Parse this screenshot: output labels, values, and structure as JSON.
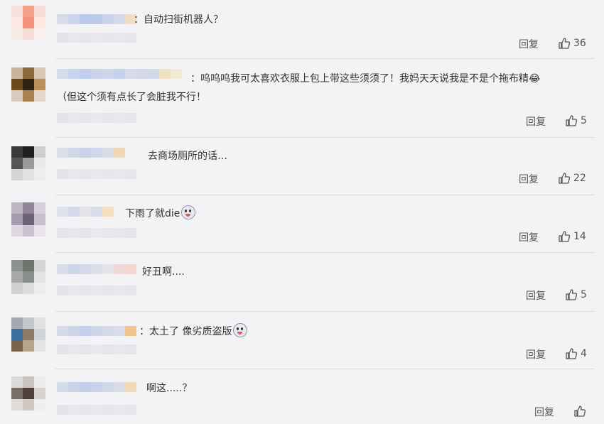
{
  "comments": [
    {
      "text": "：自动扫街机器人？",
      "reply": "回复",
      "likes": "36"
    },
    {
      "text": "：呜呜呜我可太喜欢衣服上包上带这些须须了！我妈天天说我是不是个拖布精😂",
      "text2": "（但这个须有点长了会脏我不行！",
      "reply": "回复",
      "likes": "5"
    },
    {
      "text": "去商场厕所的话…",
      "reply": "回复",
      "likes": "22"
    },
    {
      "text": "下雨了就die",
      "reply": "回复",
      "likes": "14"
    },
    {
      "text": "好丑啊....",
      "reply": "回复",
      "likes": "5"
    },
    {
      "text": "：太土了 像劣质盗版",
      "reply": "回复",
      "likes": "4"
    },
    {
      "text": "啊这.....？",
      "reply": "回复",
      "likes": ""
    }
  ]
}
